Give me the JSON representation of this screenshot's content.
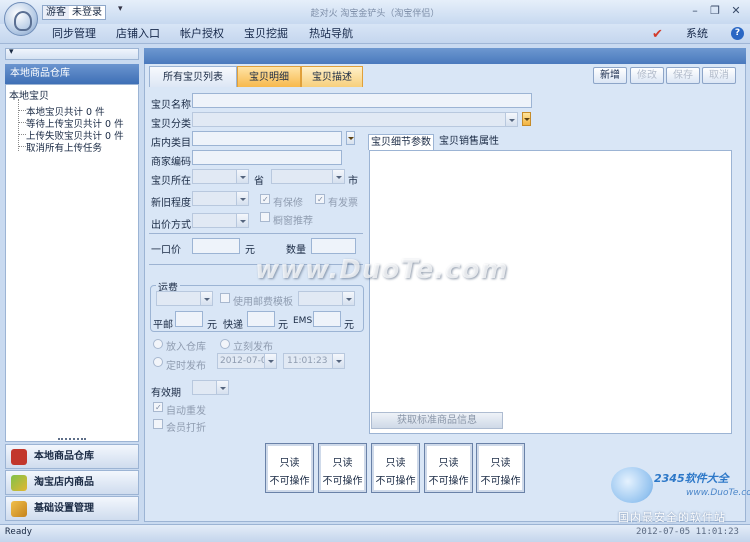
{
  "titlebar": {
    "guest": "游客",
    "not_logged_in": "未登录",
    "quick_arrow": "▾",
    "window_title": "趁对火  淘宝金铲头（淘宝伴侣）",
    "minimize": "–",
    "restore": "❐",
    "close": "✕"
  },
  "menu": {
    "items": [
      "同步管理",
      "店铺入口",
      "帐户授权",
      "宝贝挖掘",
      "热站导航"
    ],
    "system": "系统",
    "help": "?"
  },
  "left": {
    "topstrip": "▾",
    "header": "本地商品仓库",
    "tree_root": "本地宝贝",
    "tree_items": [
      "本地宝贝共计 0 件",
      "等待上传宝贝共计 0 件",
      "上传失败宝贝共计 0 件",
      "取消所有上传任务"
    ],
    "nav": [
      "本地商品仓库",
      "淘宝店内商品",
      "基础设置管理"
    ]
  },
  "tabs": [
    "所有宝贝列表",
    "宝贝明细",
    "宝贝描述"
  ],
  "actions": [
    "新增",
    "修改",
    "保存",
    "取消"
  ],
  "form": {
    "item_name": "宝贝名称",
    "item_category": "宝贝分类",
    "shop_category": "店内类目",
    "merchant_code": "商家编码",
    "location": "宝贝所在",
    "province": "省",
    "city": "市",
    "condition": "新旧程度",
    "warranty": "有保修",
    "invoice": "有发票",
    "recommend": "橱窗推荐",
    "sale_method": "出价方式",
    "price": "一口价",
    "yuan": "元",
    "quantity": "数量",
    "freight": "运费",
    "use_template": "使用邮费模板",
    "surface_mail": "平邮",
    "express": "快递",
    "ems": "EMS",
    "to_warehouse": "放入仓库",
    "publish_now": "立刻发布",
    "scheduled": "定时发布",
    "date_value": "2012-07-0",
    "time_value": "11:01:23",
    "validity": "有效期",
    "auto_repost": "自动重发",
    "vip_discount": "会员打折"
  },
  "detail": {
    "tab_params": "宝贝细节参数",
    "tab_sales": "宝贝销售属性",
    "get_std_info": "获取标准商品信息"
  },
  "readonly_boxes": [
    {
      "top": "只读",
      "bottom": "不可操作"
    },
    {
      "top": "只读",
      "bottom": "不可操作"
    },
    {
      "top": "只读",
      "bottom": "不可操作"
    },
    {
      "top": "只读",
      "bottom": "不可操作"
    },
    {
      "top": "只读",
      "bottom": "不可操作"
    }
  ],
  "watermarks": {
    "main": "www.DuoTe.com",
    "brand": "2345软件大全",
    "url": "www.DuoTe.com",
    "slogan": "国内最安全的软件站"
  },
  "status": {
    "text": "Ready",
    "datetime": "2012-07-05  11:01:23"
  },
  "colors": {
    "accent_orange": "#f7b94d",
    "header_blue": "#3e6fb6",
    "panel_bg": "#d9e6f6"
  }
}
